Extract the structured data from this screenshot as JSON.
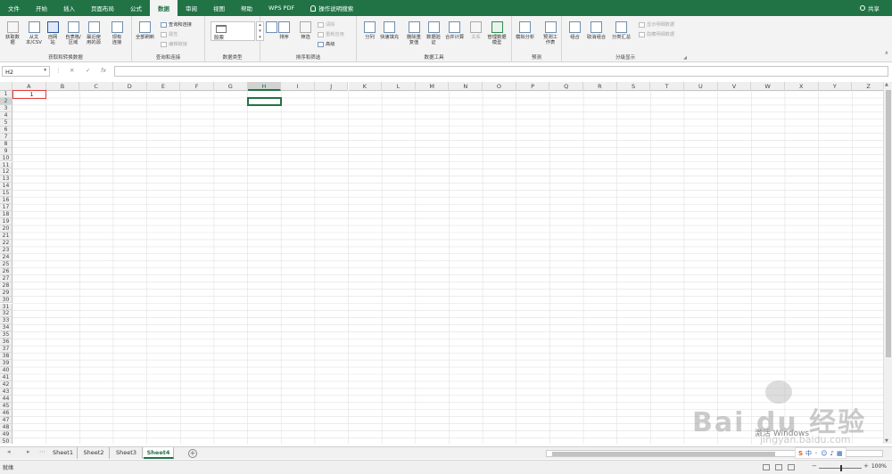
{
  "ribbon_tabs": [
    "文件",
    "开始",
    "插入",
    "页面布局",
    "公式",
    "数据",
    "审阅",
    "视图",
    "帮助",
    "WPS PDF"
  ],
  "active_tab": "数据",
  "tell_me": "操作说明搜索",
  "share": "共享",
  "groups": {
    "get_transform": {
      "label": "获取和转换数据",
      "buttons": [
        "获取数据",
        "从文本/CSV",
        "自网站",
        "自表格/区域",
        "最近使用的源",
        "现有连接"
      ]
    },
    "queries": {
      "label": "查询和连接",
      "refresh_all": "全部刷新",
      "items": [
        "查询和连接",
        "属性",
        "编辑链接"
      ]
    },
    "data_types": {
      "label": "数据类型",
      "item": "股票"
    },
    "sort_filter": {
      "label": "排序和筛选",
      "sort": "排序",
      "filter": "筛选",
      "small": [
        "清除",
        "重新应用",
        "高级"
      ]
    },
    "data_tools": {
      "label": "数据工具",
      "buttons": [
        "分列",
        "快速填充",
        "删除重复值",
        "数据验证",
        "合并计算",
        "关系",
        "管理数据模型"
      ]
    },
    "forecast": {
      "label": "预测",
      "buttons": [
        "模拟分析",
        "预测工作表"
      ]
    },
    "outline": {
      "label": "分级显示",
      "buttons": [
        "组合",
        "取消组合",
        "分类汇总"
      ],
      "small": [
        "显示明细数据",
        "隐藏明细数据"
      ]
    }
  },
  "name_box": "H2",
  "formula_icons": {
    "cancel": "✕",
    "enter": "✓",
    "fx": "fx"
  },
  "columns": [
    "A",
    "B",
    "C",
    "D",
    "E",
    "F",
    "G",
    "H",
    "I",
    "J",
    "K",
    "L",
    "M",
    "N",
    "O",
    "P",
    "Q",
    "R",
    "S",
    "T",
    "U",
    "V",
    "W",
    "X",
    "Y",
    "Z"
  ],
  "selected_column": "H",
  "rows": [
    "1",
    "2",
    "3",
    "4",
    "5",
    "6",
    "7",
    "8",
    "9",
    "10",
    "11",
    "12",
    "13",
    "14",
    "15",
    "16",
    "17",
    "18",
    "19",
    "20",
    "21",
    "22",
    "23",
    "24",
    "25",
    "26",
    "27",
    "28",
    "29",
    "30",
    "31",
    "32",
    "33",
    "34",
    "35",
    "36",
    "37",
    "38",
    "39",
    "40",
    "41",
    "42",
    "43",
    "44",
    "45",
    "46",
    "47",
    "48",
    "49",
    "50"
  ],
  "selected_row": "2",
  "cells": {
    "A1": "1"
  },
  "sheets": [
    "Sheet1",
    "Sheet2",
    "Sheet3",
    "Sheet4"
  ],
  "active_sheet": "Sheet4",
  "add_sheet": "+",
  "status": "就绪",
  "zoom": "100%",
  "ime": {
    "logo": "S",
    "lang": "中"
  },
  "windows_activation": "激活 Windows",
  "watermark": {
    "brand": "Bai du 经验",
    "url": "jingyan.baidu.com"
  },
  "colors": {
    "excel_green": "#217346",
    "highlight_red": "#e23b3b"
  }
}
